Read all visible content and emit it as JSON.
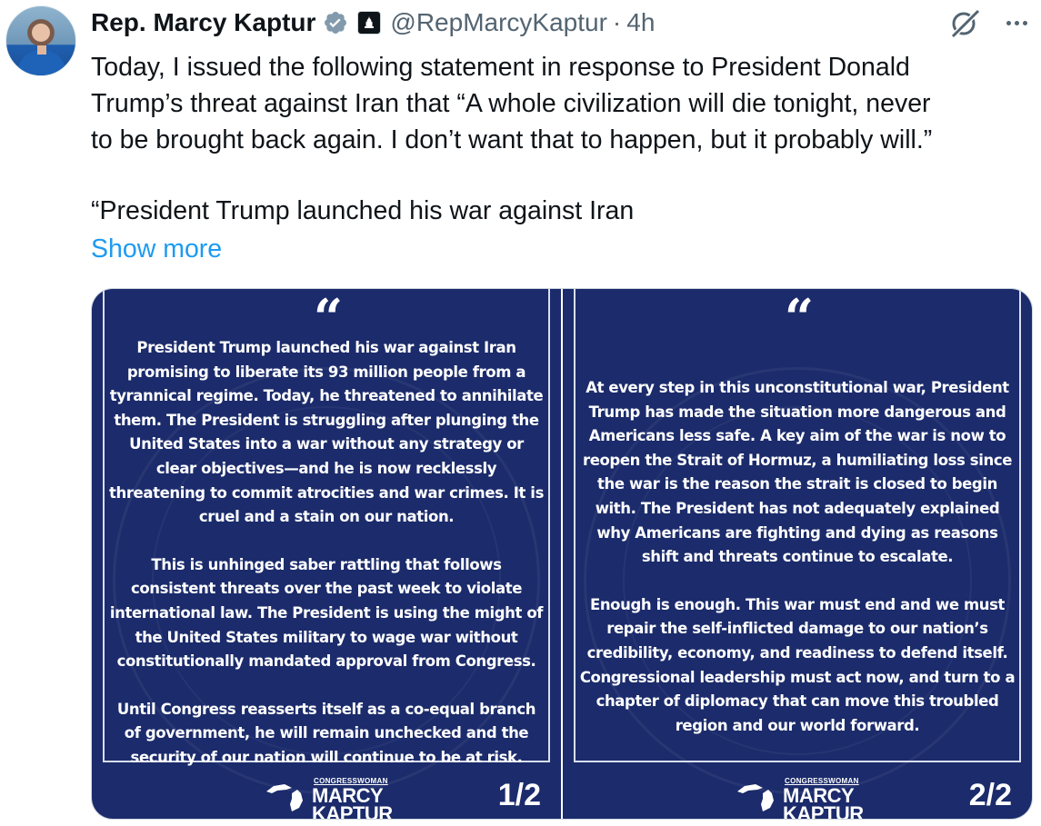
{
  "author": {
    "name": "Rep. Marcy Kaptur",
    "handle": "@RepMarcyKaptur",
    "separator": "·",
    "time": "4h",
    "verified_icon": "verified-badge-icon",
    "affiliation_icon": "capitol-badge-icon"
  },
  "tweet": {
    "lines": [
      "Today, I issued the following statement in response to President Donald",
      "Trump’s threat against Iran that “A whole civilization will die tonight, never",
      "to be brought back again. I don’t want that to happen, but it probably will.”"
    ],
    "line2": "“President Trump launched his war against Iran",
    "show_more": "Show more"
  },
  "colors": {
    "link": "#1d9bf0",
    "card_bg": "#1b2b6b",
    "muted": "#536471"
  },
  "cards": [
    {
      "quote_mark": "“",
      "paragraphs": [
        "President Trump launched his war against Iran promising to liberate its 93 million people from a tyrannical regime. Today, he threatened to annihilate them. The President is struggling after plunging the United States into a war without any strategy or clear objectives—and he is now recklessly threatening to commit atrocities and war crimes. It is cruel and a stain on our nation.",
        "This is unhinged saber rattling that follows consistent threats over the past week to violate international law. The President is using the might of the United States military to wage war without constitutionally mandated approval from Congress.",
        "Until Congress reasserts itself as a co-equal branch of government, he will remain unchecked and the security of our nation will continue to be at risk."
      ],
      "logo_small": "CONGRESSWOMAN",
      "logo_line1": "MARCY",
      "logo_line2": "KAPTUR",
      "page": "1/2"
    },
    {
      "quote_mark": "“",
      "paragraphs": [
        "At every step in this unconstitutional war, President Trump has made the situation more dangerous and Americans less safe. A key aim of the war is now to reopen the Strait of Hormuz, a humiliating loss since the war is the reason the strait is closed to begin with. The President has not adequately explained why Americans are fighting and dying as reasons shift and threats continue to escalate.",
        "Enough is enough. This war must end and we must repair the self-inflicted damage to our nation’s credibility, economy, and readiness to defend itself. Congressional leadership must act now, and turn to a chapter of diplomacy that can move this troubled region and our world forward."
      ],
      "logo_small": "CONGRESSWOMAN",
      "logo_line1": "MARCY",
      "logo_line2": "KAPTUR",
      "page": "2/2"
    }
  ]
}
